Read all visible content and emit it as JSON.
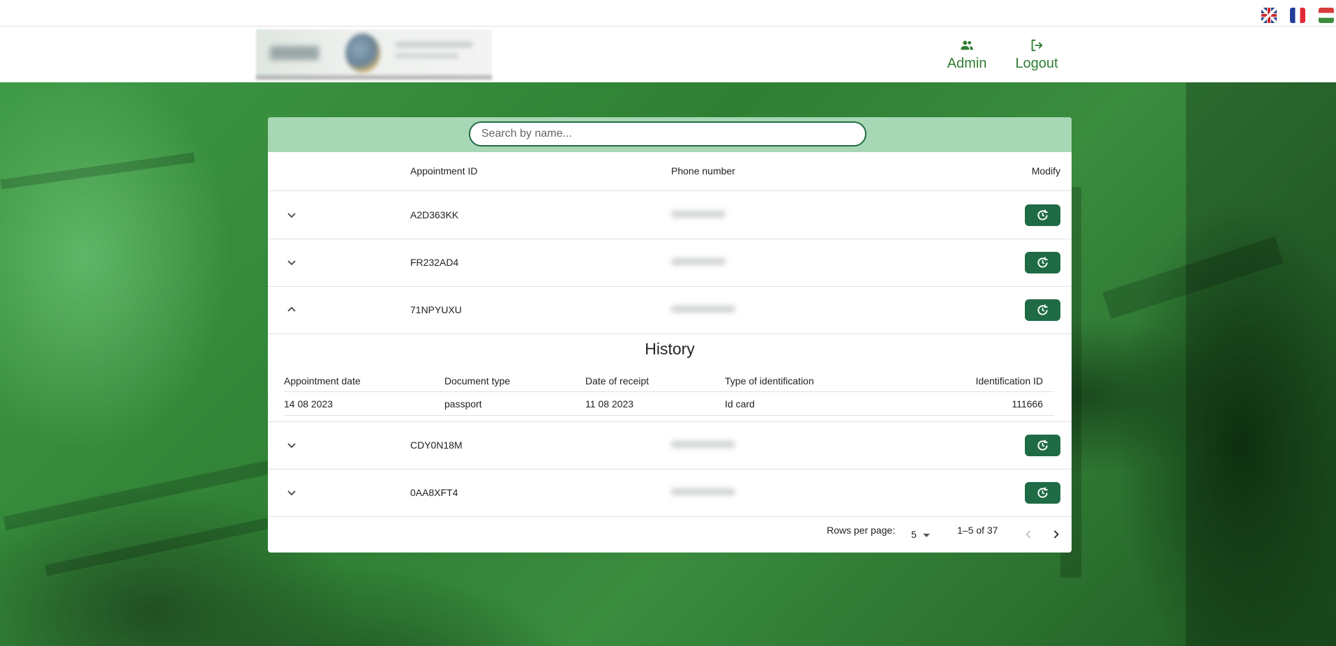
{
  "languages": [
    {
      "name": "English",
      "icon": "uk-flag-icon"
    },
    {
      "name": "Français",
      "icon": "fr-flag-icon"
    },
    {
      "name": "Magyar",
      "icon": "hu-flag-icon"
    }
  ],
  "nav": {
    "admin_label": "Admin",
    "logout_label": "Logout"
  },
  "search": {
    "placeholder": "Search by name..."
  },
  "table": {
    "headers": {
      "appointment_id": "Appointment ID",
      "phone": "Phone number",
      "modify": "Modify"
    },
    "rows": [
      {
        "id": "A2D363KK",
        "expanded": false
      },
      {
        "id": "FR232AD4",
        "expanded": false
      },
      {
        "id": "71NPYUXU",
        "expanded": true
      },
      {
        "id": "CDY0N18M",
        "expanded": false
      },
      {
        "id": "0AA8XFT4",
        "expanded": false
      }
    ]
  },
  "history": {
    "title": "History",
    "headers": {
      "appointment_date": "Appointment date",
      "document_type": "Document type",
      "date_of_receipt": "Date of receipt",
      "identification_type": "Type of identification",
      "identification_id": "Identification ID"
    },
    "rows": [
      {
        "appointment_date": "14 08 2023",
        "document_type": "passport",
        "date_of_receipt": "11 08 2023",
        "identification_type": "Id card",
        "identification_id": "111666"
      }
    ]
  },
  "pagination": {
    "rows_per_page_label": "Rows per page:",
    "rows_per_page": "5",
    "range": "1–5 of 37"
  },
  "colors": {
    "primary": "#1f6b45",
    "accent_green": "#2e7d32",
    "search_band": "#a7d7b4"
  }
}
